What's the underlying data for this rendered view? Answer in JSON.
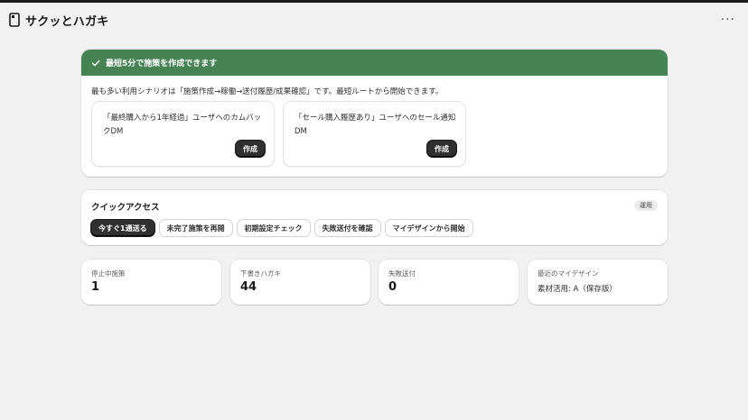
{
  "app": {
    "title": "サクッとハガキ",
    "more": "···"
  },
  "banner": {
    "heading": "最短5分で施策を作成できます",
    "description": "最も多い利用シナリオは「施策作成→稼働→送付履歴/成果確認」です。最短ルートから開始できます。",
    "scenarios": [
      {
        "text": "「最終購入から1年経過」ユーザへのカムバックDM",
        "button": "作成"
      },
      {
        "text": "「セール購入履歴あり」ユーザへのセール通知DM",
        "button": "作成"
      }
    ],
    "accent_color": "#468353"
  },
  "quick_access": {
    "title": "クイックアクセス",
    "badge": "運用",
    "buttons": [
      {
        "label": "今すぐ1通送る",
        "primary": true
      },
      {
        "label": "未完了施策を再開",
        "primary": false
      },
      {
        "label": "初期設定チェック",
        "primary": false
      },
      {
        "label": "失敗送付を確認",
        "primary": false
      },
      {
        "label": "マイデザインから開始",
        "primary": false
      }
    ]
  },
  "stats": [
    {
      "label": "停止中施策",
      "value": "1"
    },
    {
      "label": "下書きハガキ",
      "value": "44"
    },
    {
      "label": "失敗送付",
      "value": "0"
    },
    {
      "label": "最近のマイデザイン",
      "value": "素材活用: A（保存版）"
    }
  ]
}
